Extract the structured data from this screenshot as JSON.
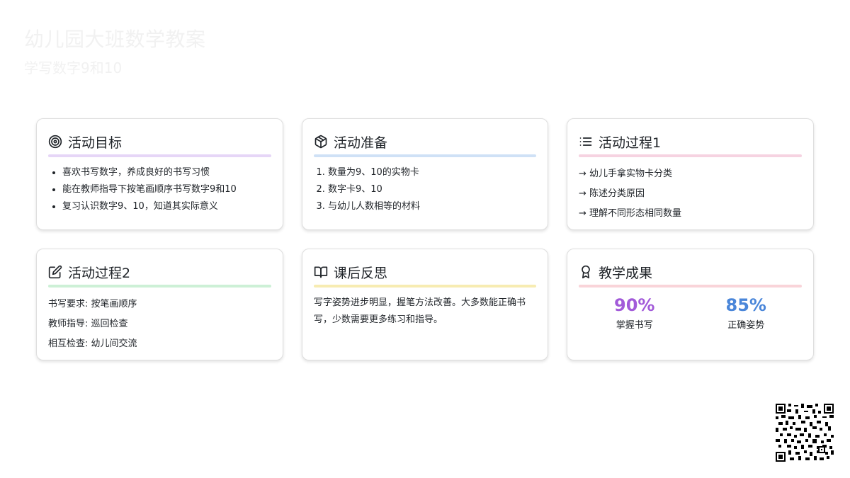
{
  "header": {
    "title": "幼儿园大班数学教案",
    "subtitle": "学写数字9和10"
  },
  "cards": [
    {
      "title": "活动目标",
      "icon": "target-icon",
      "accent": "#e6d6f7",
      "items": [
        "喜欢书写数字，养成良好的书写习惯",
        "能在教师指导下按笔画顺序书写数字9和10",
        "复习认识数字9、10，知道其实际意义"
      ]
    },
    {
      "title": "活动准备",
      "icon": "box-icon",
      "accent": "#cfe1f6",
      "items": [
        "数量为9、10的实物卡",
        "数字卡9、10",
        "与幼儿人数相等的材料"
      ]
    },
    {
      "title": "活动过程1",
      "icon": "list-icon",
      "accent": "#f6d3e1",
      "items": [
        "→ 幼儿手拿实物卡分类",
        "→ 陈述分类原因",
        "→ 理解不同形态相同数量"
      ]
    },
    {
      "title": "活动过程2",
      "icon": "edit-icon",
      "accent": "#cdf0d6",
      "items": [
        "书写要求: 按笔画顺序",
        "教师指导: 巡回检查",
        "相互检查: 幼儿间交流"
      ]
    },
    {
      "title": "课后反思",
      "icon": "book-open-icon",
      "accent": "#f7ecb2",
      "text": "写字姿势进步明显，握笔方法改善。大多数能正确书写，少数需要更多练习和指导。"
    },
    {
      "title": "教学成果",
      "icon": "award-icon",
      "accent": "#f9d4d9",
      "stats": [
        {
          "value": "90%",
          "label": "掌握书写",
          "color": "#a25ad9"
        },
        {
          "value": "85%",
          "label": "正确姿势",
          "color": "#4a86d9"
        }
      ]
    }
  ]
}
